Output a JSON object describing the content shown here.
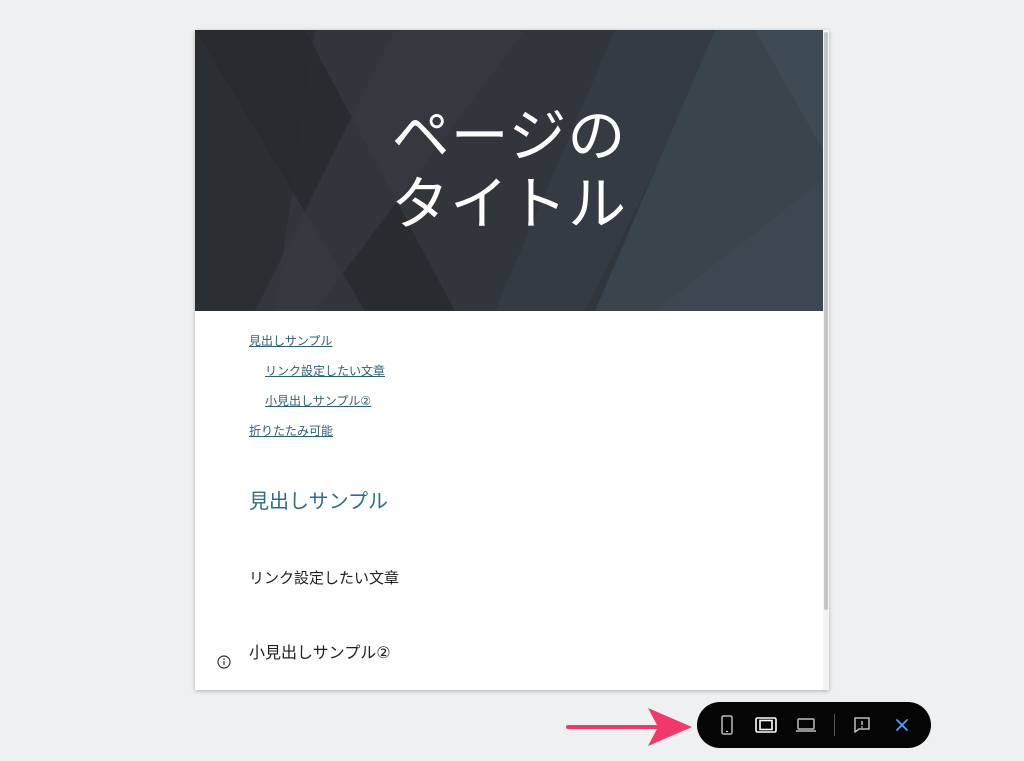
{
  "hero": {
    "title_line1": "ページの",
    "title_line2": "タイトル"
  },
  "toc": {
    "items": [
      {
        "label": "見出しサンプル",
        "level": 1
      },
      {
        "label": "リンク設定したい文章",
        "level": 2
      },
      {
        "label": "小見出しサンプル②",
        "level": 2
      },
      {
        "label": "折りたたみ可能",
        "level": 1
      }
    ]
  },
  "content": {
    "heading": "見出しサンプル",
    "paragraph": "リンク設定したい文章",
    "subheading": "小見出しサンプル②"
  },
  "toolbar": {
    "buttons": [
      {
        "name": "phone-preview",
        "icon": "phone-icon",
        "active": false
      },
      {
        "name": "tablet-preview",
        "icon": "tablet-icon",
        "active": true
      },
      {
        "name": "laptop-preview",
        "icon": "laptop-icon",
        "active": false
      },
      {
        "name": "feedback",
        "icon": "feedback-icon",
        "active": false
      },
      {
        "name": "close",
        "icon": "close-icon",
        "active": false
      }
    ]
  },
  "colors": {
    "hero_bg": "#2f353b",
    "link": "#2f6079",
    "heading": "#2f6d8c",
    "accent_arrow": "#f0386b",
    "close_icon": "#4da3ff"
  }
}
